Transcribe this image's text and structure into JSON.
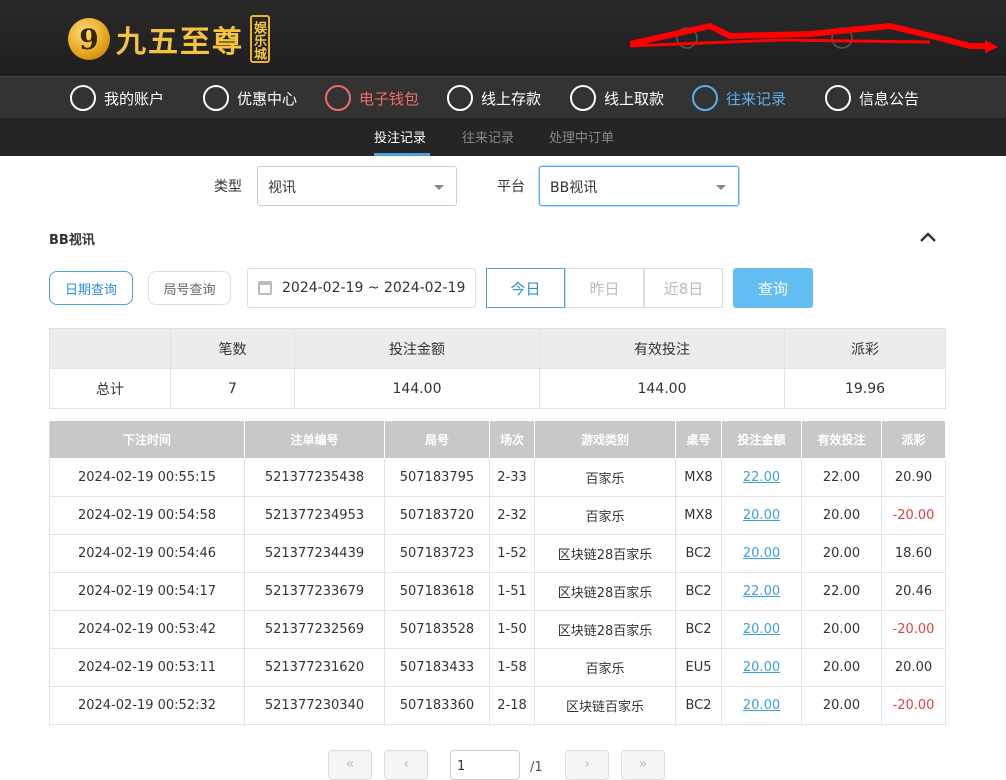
{
  "header": {
    "logo_mark": "9",
    "logo_name": "九五至尊",
    "logo_badge": "娱乐城"
  },
  "nav": [
    {
      "label": "我的账户",
      "icon": "user-icon",
      "color": "#ffffff"
    },
    {
      "label": "优惠中心",
      "icon": "gift-icon",
      "color": "#ffffff"
    },
    {
      "label": "电子钱包",
      "icon": "wallet-icon",
      "color": "#f06b6b"
    },
    {
      "label": "线上存款",
      "icon": "deposit-icon",
      "color": "#ffffff"
    },
    {
      "label": "线上取款",
      "icon": "withdraw-icon",
      "color": "#ffffff"
    },
    {
      "label": "往来记录",
      "icon": "record-icon",
      "color": "#5ab0f0"
    },
    {
      "label": "信息公告",
      "icon": "bell-icon",
      "color": "#ffffff"
    }
  ],
  "subnav": [
    {
      "label": "投注记录",
      "active": true
    },
    {
      "label": "往来记录",
      "active": false
    },
    {
      "label": "处理中订单",
      "active": false
    }
  ],
  "filters": {
    "type_label": "类型",
    "type_value": "视讯",
    "platform_label": "平台",
    "platform_value": "BB视讯"
  },
  "section_title": "BB视讯",
  "query": {
    "by_date": "日期查询",
    "by_round": "局号查询",
    "date_range": "2024-02-19 ~ 2024-02-19",
    "today": "今日",
    "yesterday": "昨日",
    "last8": "近8日",
    "search": "查询"
  },
  "summary": {
    "headers": [
      "",
      "笔数",
      "投注金额",
      "有效投注",
      "派彩"
    ],
    "row": [
      "总计",
      "7",
      "144.00",
      "144.00",
      "19.96"
    ]
  },
  "detail": {
    "headers": [
      "下注时间",
      "注单编号",
      "局号",
      "场次",
      "游戏类别",
      "桌号",
      "投注金额",
      "有效投注",
      "派彩"
    ],
    "rows": [
      [
        "2024-02-19 00:55:15",
        "521377235438",
        "507183795",
        "2-33",
        "百家乐",
        "MX8",
        "22.00",
        "22.00",
        "20.90"
      ],
      [
        "2024-02-19 00:54:58",
        "521377234953",
        "507183720",
        "2-32",
        "百家乐",
        "MX8",
        "20.00",
        "20.00",
        "-20.00"
      ],
      [
        "2024-02-19 00:54:46",
        "521377234439",
        "507183723",
        "1-52",
        "区块链28百家乐",
        "BC2",
        "20.00",
        "20.00",
        "18.60"
      ],
      [
        "2024-02-19 00:54:17",
        "521377233679",
        "507183618",
        "1-51",
        "区块链28百家乐",
        "BC2",
        "22.00",
        "22.00",
        "20.46"
      ],
      [
        "2024-02-19 00:53:42",
        "521377232569",
        "507183528",
        "1-50",
        "区块链28百家乐",
        "BC2",
        "20.00",
        "20.00",
        "-20.00"
      ],
      [
        "2024-02-19 00:53:11",
        "521377231620",
        "507183433",
        "1-58",
        "百家乐",
        "EU5",
        "20.00",
        "20.00",
        "20.00"
      ],
      [
        "2024-02-19 00:52:32",
        "521377230340",
        "507183360",
        "2-18",
        "区块链百家乐",
        "BC2",
        "20.00",
        "20.00",
        "-20.00"
      ]
    ]
  },
  "pager": {
    "current": "1",
    "total": "/1"
  }
}
